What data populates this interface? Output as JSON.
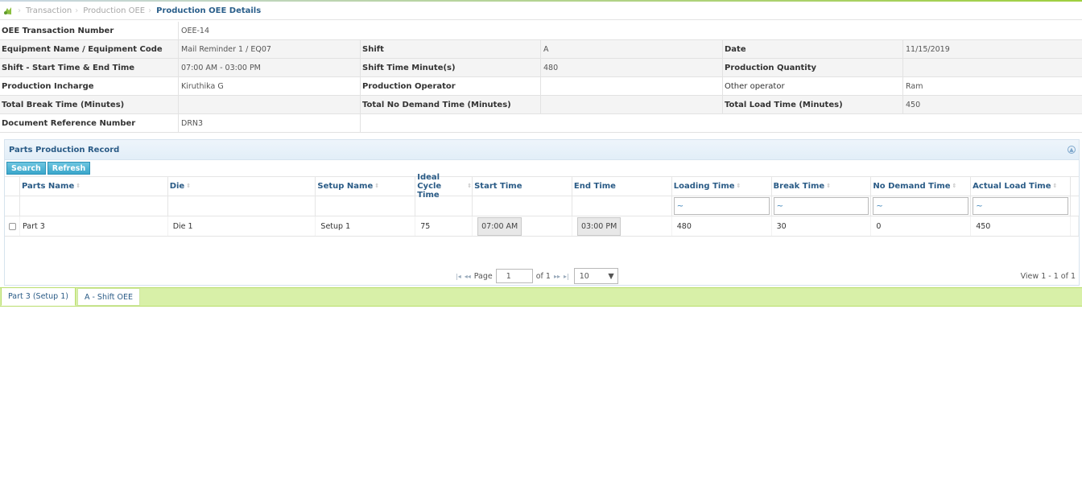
{
  "breadcrumb": {
    "items": [
      "Transaction",
      "Production OEE"
    ],
    "current": "Production OEE Details"
  },
  "info": {
    "oee_label": "OEE Transaction Number",
    "oee_value": "OEE-14",
    "equipment_label": "Equipment Name / Equipment Code",
    "equipment_value": "Mail Reminder 1 / EQ07",
    "shift_label": "Shift",
    "shift_value": "A",
    "date_label": "Date",
    "date_value": "11/15/2019",
    "shift_time_label": "Shift - Start Time & End Time",
    "shift_time_value": "07:00 AM - 03:00 PM",
    "shift_minutes_label": "Shift Time Minute(s)",
    "shift_minutes_value": "480",
    "prod_qty_label": "Production Quantity",
    "prod_qty_value": "",
    "incharge_label": "Production Incharge",
    "incharge_value": "Kiruthika G",
    "operator_label": "Production Operator",
    "operator_value": "",
    "other_operator_label": "Other operator",
    "other_operator_value": "Ram",
    "break_label": "Total Break Time (Minutes)",
    "break_value": "",
    "no_demand_label": "Total No Demand Time (Minutes)",
    "no_demand_value": "",
    "load_label": "Total Load Time (Minutes)",
    "load_value": "450",
    "doc_ref_label": "Document Reference Number",
    "doc_ref_value": "DRN3"
  },
  "grid": {
    "title": "Parts Production Record",
    "search_label": "Search",
    "refresh_label": "Refresh",
    "columns": {
      "parts_name": "Parts Name",
      "die": "Die",
      "setup_name": "Setup Name",
      "ideal_cycle": "Ideal Cycle Time",
      "start_time": "Start Time",
      "end_time": "End Time",
      "loading_time": "Loading Time",
      "break_time": "Break Time",
      "no_demand_time": "No Demand Time",
      "actual_load_time": "Actual Load Time"
    },
    "filter_symbol": "~",
    "row": {
      "parts_name": "Part 3",
      "die": "Die 1",
      "setup_name": "Setup 1",
      "ideal_cycle": "75",
      "start_time": "07:00 AM",
      "end_time": "03:00 PM",
      "loading_time": "480",
      "break_time": "30",
      "no_demand_time": "0",
      "actual_load_time": "450"
    },
    "pager": {
      "page_label": "Page",
      "page_value": "1",
      "of_label": "of 1",
      "rows_value": "10",
      "view_text": "View 1 - 1 of 1"
    }
  },
  "tabs": [
    "Part 3 (Setup 1)",
    "A - Shift OEE"
  ]
}
